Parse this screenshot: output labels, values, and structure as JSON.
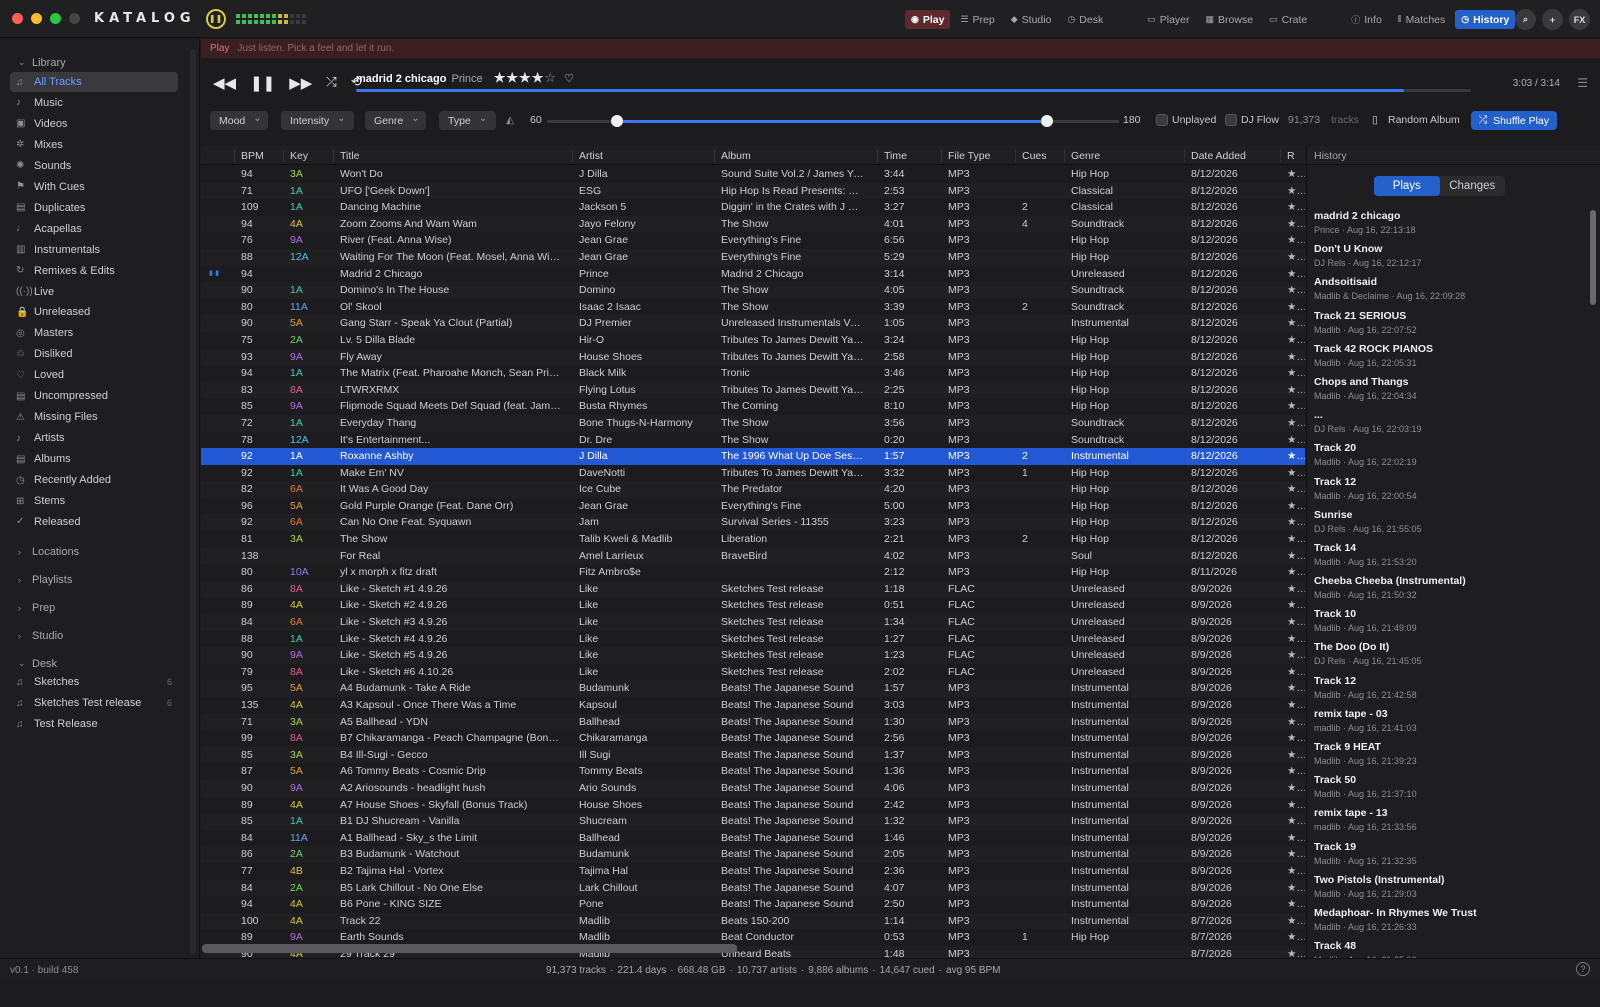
{
  "app": {
    "logo": "KATALOG",
    "version": "v0.1 · build 458"
  },
  "modes": [
    {
      "label": "Play",
      "icon": "◉",
      "active": "red"
    },
    {
      "label": "Prep",
      "icon": "☰"
    },
    {
      "label": "Studio",
      "icon": "◆"
    },
    {
      "label": "Desk",
      "icon": "◷"
    }
  ],
  "views": [
    {
      "label": "Player",
      "icon": "▭"
    },
    {
      "label": "Browse",
      "icon": "▦"
    },
    {
      "label": "Crate",
      "icon": "▭"
    }
  ],
  "panels": [
    {
      "label": "Info",
      "icon": "ⓘ"
    },
    {
      "label": "Matches",
      "icon": "⫴"
    },
    {
      "label": "History",
      "icon": "◷",
      "active": "blue"
    }
  ],
  "right_buttons": [
    "⌕",
    "+",
    "FX"
  ],
  "sidebar": {
    "library_label": "Library",
    "items": [
      {
        "label": "All Tracks",
        "icon": "♫",
        "selected": true
      },
      {
        "label": "Music",
        "icon": "♪"
      },
      {
        "label": "Videos",
        "icon": "▣"
      },
      {
        "label": "Mixes",
        "icon": "✲"
      },
      {
        "label": "Sounds",
        "icon": "✺"
      },
      {
        "label": "With Cues",
        "icon": "⚑"
      },
      {
        "label": "Duplicates",
        "icon": "▤"
      },
      {
        "label": "Acapellas",
        "icon": "♩"
      },
      {
        "label": "Instrumentals",
        "icon": "▥"
      },
      {
        "label": "Remixes & Edits",
        "icon": "↻"
      },
      {
        "label": "Live",
        "icon": "((·))"
      },
      {
        "label": "Unreleased",
        "icon": "🔒"
      },
      {
        "label": "Masters",
        "icon": "◎"
      },
      {
        "label": "Disliked",
        "icon": "♲"
      },
      {
        "label": "Loved",
        "icon": "♡"
      },
      {
        "label": "Uncompressed",
        "icon": "▤"
      },
      {
        "label": "Missing Files",
        "icon": "⚠"
      },
      {
        "label": "Artists",
        "icon": "♪"
      },
      {
        "label": "Albums",
        "icon": "▤"
      },
      {
        "label": "Recently Added",
        "icon": "◷"
      },
      {
        "label": "Stems",
        "icon": "⊞"
      },
      {
        "label": "Released",
        "icon": "✓"
      }
    ],
    "sections": [
      "Locations",
      "Playlists",
      "Prep",
      "Studio"
    ],
    "desk_label": "Desk",
    "desk_items": [
      {
        "label": "Sketches",
        "count": "6"
      },
      {
        "label": "Sketches Test release",
        "count": "6"
      },
      {
        "label": "Test Release",
        "count": ""
      }
    ]
  },
  "playband": {
    "mode": "Play",
    "hint": "Just listen. Pick a feel and let it run."
  },
  "player": {
    "title": "madrid 2 chicago",
    "artist": "Prince",
    "stars": "★★★★",
    "empty_star": "☆",
    "heart": "♡",
    "time": "3:03 / 3:14",
    "progress": 0.94
  },
  "filters": {
    "mood": "Mood",
    "intensity": "Intensity",
    "genre": "Genre",
    "type": "Type",
    "bpm_min": "60",
    "bpm_max": "180",
    "unplayed": "Unplayed",
    "djflow": "DJ Flow",
    "count": "91,373",
    "count_unit": "tracks",
    "random_album": "Random Album",
    "shuffle": "Shuffle Play"
  },
  "columns": [
    "BPM",
    "Key",
    "Title",
    "Artist",
    "Album",
    "Time",
    "File Type",
    "Cues",
    "Genre",
    "Date Added",
    "R"
  ],
  "rows": [
    [
      "94",
      "3A",
      "Won't Do",
      "J Dilla",
      "Sound Suite Vol.2 / James Ya...",
      "3:44",
      "MP3",
      "",
      "Hip Hop",
      "8/12/2026"
    ],
    [
      "71",
      "1A",
      "UFO ['Geek Down']",
      "ESG",
      "Hip Hop Is Read Presents: Do...",
      "2:53",
      "MP3",
      "",
      "Classical",
      "8/12/2026"
    ],
    [
      "109",
      "1A",
      "Dancing Machine",
      "Jackson 5",
      "Diggin' in the Crates with J Di...",
      "3:27",
      "MP3",
      "2",
      "Classical",
      "8/12/2026"
    ],
    [
      "94",
      "4A",
      "Zoom Zooms And Wam Wam",
      "Jayo Felony",
      "The Show",
      "4:01",
      "MP3",
      "4",
      "Soundtrack",
      "8/12/2026"
    ],
    [
      "76",
      "9A",
      "River (Feat. Anna Wise)",
      "Jean Grae",
      "Everything's Fine",
      "6:56",
      "MP3",
      "",
      "Hip Hop",
      "8/12/2026"
    ],
    [
      "88",
      "12A",
      "Waiting For The Moon (Feat. Mosel, Anna Wise)",
      "Jean Grae",
      "Everything's Fine",
      "5:29",
      "MP3",
      "",
      "Hip Hop",
      "8/12/2026"
    ],
    [
      "94",
      "",
      "Madrid 2 Chicago",
      "Prince",
      "Madrid 2 Chicago",
      "3:14",
      "MP3",
      "",
      "Unreleased",
      "8/12/2026"
    ],
    [
      "90",
      "1A",
      "Domino's In The House",
      "Domino",
      "The Show",
      "4:05",
      "MP3",
      "",
      "Soundtrack",
      "8/12/2026"
    ],
    [
      "80",
      "11A",
      "Ol' Skool",
      "Isaac 2 Isaac",
      "The Show",
      "3:39",
      "MP3",
      "2",
      "Soundtrack",
      "8/12/2026"
    ],
    [
      "90",
      "5A",
      "Gang Starr - Speak Ya Clout (Partial)",
      "DJ Premier",
      "Unreleased Instrumentals Vol....",
      "1:05",
      "MP3",
      "",
      "Instrumental",
      "8/12/2026"
    ],
    [
      "75",
      "2A",
      "Lv. 5 Dilla Blade",
      "Hir-O",
      "Tributes To James Dewitt Yan...",
      "3:24",
      "MP3",
      "",
      "Hip Hop",
      "8/12/2026"
    ],
    [
      "93",
      "9A",
      "Fly Away",
      "House Shoes",
      "Tributes To James Dewitt Yan...",
      "2:58",
      "MP3",
      "",
      "Hip Hop",
      "8/12/2026"
    ],
    [
      "94",
      "1A",
      "The Matrix (Feat. Pharoahe Monch, Sean Price...",
      "Black Milk",
      "Tronic",
      "3:46",
      "MP3",
      "",
      "Hip Hop",
      "8/12/2026"
    ],
    [
      "83",
      "8A",
      "LTWRXRMX",
      "Flying Lotus",
      "Tributes To James Dewitt Yan...",
      "2:25",
      "MP3",
      "",
      "Hip Hop",
      "8/12/2026"
    ],
    [
      "85",
      "9A",
      "Flipmode Squad Meets Def Squad (feat. Jamal...",
      "Busta Rhymes",
      "The Coming",
      "8:10",
      "MP3",
      "",
      "Hip Hop",
      "8/12/2026"
    ],
    [
      "72",
      "1A",
      "Everyday Thang",
      "Bone Thugs-N-Harmony",
      "The Show",
      "3:56",
      "MP3",
      "",
      "Soundtrack",
      "8/12/2026"
    ],
    [
      "78",
      "12A",
      "It's Entertainment...",
      "Dr. Dre",
      "The Show",
      "0:20",
      "MP3",
      "",
      "Soundtrack",
      "8/12/2026"
    ],
    [
      "92",
      "1A",
      "Roxanne Ashby",
      "J Dilla",
      "The 1996 What Up Doe Sessi...",
      "1:57",
      "MP3",
      "2",
      "Instrumental",
      "8/12/2026"
    ],
    [
      "92",
      "1A",
      "Make Em' NV",
      "DaveNotti",
      "Tributes To James Dewitt Yan...",
      "3:32",
      "MP3",
      "1",
      "Hip Hop",
      "8/12/2026"
    ],
    [
      "82",
      "6A",
      "It Was A Good Day",
      "Ice Cube",
      "The Predator",
      "4:20",
      "MP3",
      "",
      "Hip Hop",
      "8/12/2026"
    ],
    [
      "96",
      "5A",
      "Gold Purple Orange (Feat. Dane Orr)",
      "Jean Grae",
      "Everything's Fine",
      "5:00",
      "MP3",
      "",
      "Hip Hop",
      "8/12/2026"
    ],
    [
      "92",
      "6A",
      "Can No One Feat. Syquawn",
      "Jam",
      "Survival Series - 11355",
      "3:23",
      "MP3",
      "",
      "Hip Hop",
      "8/12/2026"
    ],
    [
      "81",
      "3A",
      "The Show",
      "Talib Kweli & Madlib",
      "Liberation",
      "2:21",
      "MP3",
      "2",
      "Hip Hop",
      "8/12/2026"
    ],
    [
      "138",
      "",
      "For Real",
      "Amel Larrieux",
      "BraveBird",
      "4:02",
      "MP3",
      "",
      "Soul",
      "8/12/2026"
    ],
    [
      "80",
      "10A",
      "yl x morph x fitz draft",
      "Fitz Ambro$e",
      "",
      "2:12",
      "MP3",
      "",
      "Hip Hop",
      "8/11/2026"
    ],
    [
      "86",
      "8A",
      "Like - Sketch #1 4.9.26",
      "Like",
      "Sketches Test release",
      "1:18",
      "FLAC",
      "",
      "Unreleased",
      "8/9/2026"
    ],
    [
      "89",
      "4A",
      "Like - Sketch #2 4.9.26",
      "Like",
      "Sketches Test release",
      "0:51",
      "FLAC",
      "",
      "Unreleased",
      "8/9/2026"
    ],
    [
      "84",
      "6A",
      "Like - Sketch #3 4.9.26",
      "Like",
      "Sketches Test release",
      "1:34",
      "FLAC",
      "",
      "Unreleased",
      "8/9/2026"
    ],
    [
      "88",
      "1A",
      "Like - Sketch #4 4.9.26",
      "Like",
      "Sketches Test release",
      "1:27",
      "FLAC",
      "",
      "Unreleased",
      "8/9/2026"
    ],
    [
      "90",
      "9A",
      "Like - Sketch #5 4.9.26",
      "Like",
      "Sketches Test release",
      "1:23",
      "FLAC",
      "",
      "Unreleased",
      "8/9/2026"
    ],
    [
      "79",
      "8A",
      "Like - Sketch #6 4.10.26",
      "Like",
      "Sketches Test release",
      "2:02",
      "FLAC",
      "",
      "Unreleased",
      "8/9/2026"
    ],
    [
      "95",
      "5A",
      "A4 Budamunk - Take A Ride",
      "Budamunk",
      "Beats! The Japanese Sound",
      "1:57",
      "MP3",
      "",
      "Instrumental",
      "8/9/2026"
    ],
    [
      "135",
      "4A",
      "A3 Kapsoul - Once There Was a Time",
      "Kapsoul",
      "Beats! The Japanese Sound",
      "3:03",
      "MP3",
      "",
      "Instrumental",
      "8/9/2026"
    ],
    [
      "71",
      "3A",
      "A5 Ballhead - YDN",
      "Ballhead",
      "Beats! The Japanese Sound",
      "1:30",
      "MP3",
      "",
      "Instrumental",
      "8/9/2026"
    ],
    [
      "99",
      "8A",
      "B7 Chikaramanga - Peach Champagne (Bonus...",
      "Chikaramanga",
      "Beats! The Japanese Sound",
      "2:56",
      "MP3",
      "",
      "Instrumental",
      "8/9/2026"
    ],
    [
      "85",
      "3A",
      "B4 Ill-Sugi - Gecco",
      "Ill Sugi",
      "Beats! The Japanese Sound",
      "1:37",
      "MP3",
      "",
      "Instrumental",
      "8/9/2026"
    ],
    [
      "87",
      "5A",
      "A6 Tommy Beats - Cosmic Drip",
      "Tommy Beats",
      "Beats! The Japanese Sound",
      "1:36",
      "MP3",
      "",
      "Instrumental",
      "8/9/2026"
    ],
    [
      "90",
      "9A",
      "A2 Ariosounds - headlight hush",
      "Ario Sounds",
      "Beats! The Japanese Sound",
      "4:06",
      "MP3",
      "",
      "Instrumental",
      "8/9/2026"
    ],
    [
      "89",
      "4A",
      "A7 House Shoes - Skyfall (Bonus Track)",
      "House Shoes",
      "Beats! The Japanese Sound",
      "2:42",
      "MP3",
      "",
      "Instrumental",
      "8/9/2026"
    ],
    [
      "85",
      "1A",
      "B1 DJ Shucream - Vanilla",
      "Shucream",
      "Beats! The Japanese Sound",
      "1:32",
      "MP3",
      "",
      "Instrumental",
      "8/9/2026"
    ],
    [
      "84",
      "11A",
      "A1 Ballhead - Sky_s the Limit",
      "Ballhead",
      "Beats! The Japanese Sound",
      "1:46",
      "MP3",
      "",
      "Instrumental",
      "8/9/2026"
    ],
    [
      "86",
      "2A",
      "B3 Budamunk - Watchout",
      "Budamunk",
      "Beats! The Japanese Sound",
      "2:05",
      "MP3",
      "",
      "Instrumental",
      "8/9/2026"
    ],
    [
      "77",
      "4B",
      "B2 Tajima Hal - Vortex",
      "Tajima Hal",
      "Beats! The Japanese Sound",
      "2:36",
      "MP3",
      "",
      "Instrumental",
      "8/9/2026"
    ],
    [
      "84",
      "2A",
      "B5 Lark Chillout - No One Else",
      "Lark Chillout",
      "Beats! The Japanese Sound",
      "4:07",
      "MP3",
      "",
      "Instrumental",
      "8/9/2026"
    ],
    [
      "94",
      "4A",
      "B6 Pone - KING SIZE",
      "Pone",
      "Beats! The Japanese Sound",
      "2:50",
      "MP3",
      "",
      "Instrumental",
      "8/9/2026"
    ],
    [
      "100",
      "4A",
      "Track 22",
      "Madlib",
      "Beats 150-200",
      "1:14",
      "MP3",
      "",
      "Instrumental",
      "8/7/2026"
    ],
    [
      "89",
      "9A",
      "Earth Sounds",
      "Madlib",
      "Beat Conductor",
      "0:53",
      "MP3",
      "1",
      "Hip Hop",
      "8/7/2026"
    ],
    [
      "90",
      "4A",
      "29 Track 29",
      "Madlib",
      "Unheard Beats",
      "1:48",
      "MP3",
      "",
      "",
      "8/7/2026"
    ]
  ],
  "selected_row": 17,
  "playing_row": 6,
  "history": {
    "title": "History",
    "tab_plays": "Plays",
    "tab_changes": "Changes",
    "items": [
      [
        "madrid 2 chicago",
        "Prince · Aug 16, 22:13:18"
      ],
      [
        "Don't U Know",
        "DJ Rels · Aug 16, 22:12:17"
      ],
      [
        "Andsoitisaid",
        "Madlib & Declaime · Aug 16, 22:09:28"
      ],
      [
        "Track 21 SERIOUS",
        "Madlib · Aug 16, 22:07:52"
      ],
      [
        "Track 42 ROCK PIANOS",
        "Madlib · Aug 16, 22:05:31"
      ],
      [
        "Chops and Thangs",
        "Madlib · Aug 16, 22:04:34"
      ],
      [
        "...",
        "DJ Rels · Aug 16, 22:03:19"
      ],
      [
        "Track 20",
        "Madlib · Aug 16, 22:02:19"
      ],
      [
        "Track 12",
        "Madlib · Aug 16, 22:00:54"
      ],
      [
        "Sunrise",
        "DJ Rels · Aug 16, 21:55:05"
      ],
      [
        "Track 14",
        "Madlib · Aug 16, 21:53:20"
      ],
      [
        "Cheeba Cheeba (Instrumental)",
        "Madlib · Aug 16, 21:50:32"
      ],
      [
        "Track 10",
        "Madlib · Aug 16, 21:49:09"
      ],
      [
        "The Doo (Do It)",
        "DJ Rels · Aug 16, 21:45:05"
      ],
      [
        "Track 12",
        "Madlib · Aug 16, 21:42:58"
      ],
      [
        "remix tape - 03",
        "madlib · Aug 16, 21:41:03"
      ],
      [
        "Track 9 HEAT",
        "Madlib · Aug 16, 21:39:23"
      ],
      [
        "Track 50",
        "Madlib · Aug 16, 21:37:10"
      ],
      [
        "remix tape - 13",
        "madlib · Aug 16, 21:33:56"
      ],
      [
        "Track 19",
        "Madlib · Aug 16, 21:32:35"
      ],
      [
        "Two Pistols (Instrumental)",
        "Madlib · Aug 16, 21:29:03"
      ],
      [
        "Medaphoar- In Rhymes We Trust",
        "Madlib · Aug 16, 21:26:33"
      ],
      [
        "Track 48",
        "Madlib · Aug 16, 21:25:00"
      ]
    ]
  },
  "status": {
    "stats": [
      "91,373 tracks",
      "·",
      "221.4 days",
      "·",
      "668.48 GB",
      "·",
      "10,737 artists",
      "·",
      "9,886 albums",
      "·",
      "14,647 cued",
      "·",
      "avg 95 BPM"
    ],
    "help": "?"
  },
  "key_colors": {
    "1A": "#3fc9b0",
    "2A": "#6fd66a",
    "3A": "#a7d44e",
    "4A": "#d8c84a",
    "5A": "#e0a040",
    "6A": "#e07a40",
    "8A": "#e06090",
    "9A": "#b070e0",
    "10A": "#8a80f0",
    "11A": "#6aa0f0",
    "12A": "#50c0e0",
    "4B": "#d8c84a"
  }
}
